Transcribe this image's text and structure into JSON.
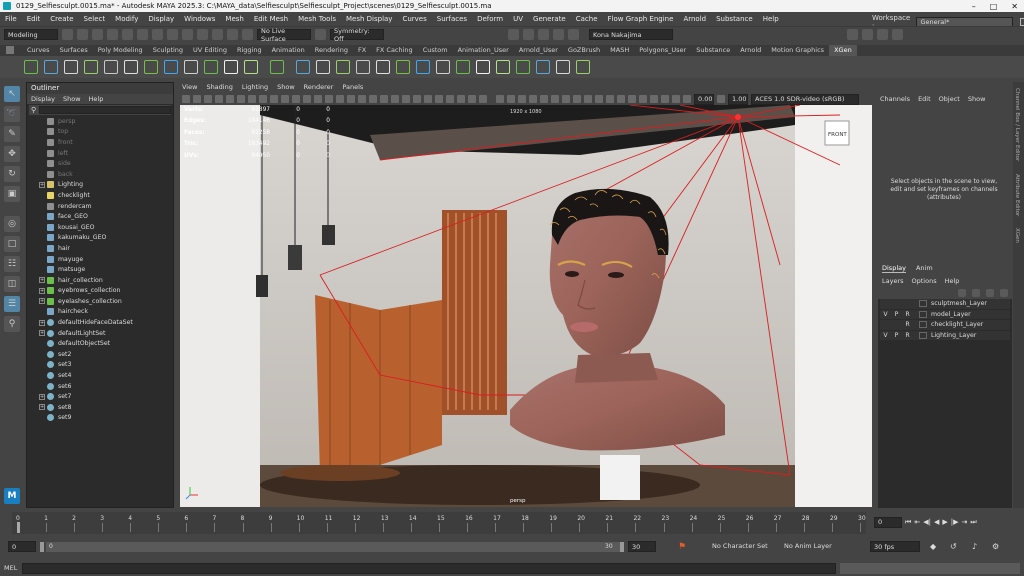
{
  "title": "0129_Selfiesculpt.0015.ma* - Autodesk MAYA 2025.3: C:\\MAYA_data\\Selfiesculpt\\Selfiesculpt_Project\\scenes\\0129_Selfiesculpt.0015.ma",
  "menus": [
    "File",
    "Edit",
    "Create",
    "Select",
    "Modify",
    "Display",
    "Windows",
    "Mesh",
    "Edit Mesh",
    "Mesh Tools",
    "Mesh Display",
    "Curves",
    "Surfaces",
    "Deform",
    "UV",
    "Generate",
    "Cache",
    "Flow Graph Engine",
    "Arnold",
    "Substance",
    "Help"
  ],
  "workspace_label": "Workspace :",
  "workspace_value": "General*",
  "mode_menu": "Modeling",
  "live_surface": "No Live Surface",
  "symmetry": "Symmetry: Off",
  "user": "Kona Nakajima",
  "shelf_tabs": [
    "Curves",
    "Surfaces",
    "Poly Modeling",
    "Sculpting",
    "UV Editing",
    "Rigging",
    "Animation",
    "Rendering",
    "FX",
    "FX Caching",
    "Custom",
    "Animation_User",
    "Arnold_User",
    "GoZBrush",
    "MASH",
    "Polygons_User",
    "Substance",
    "Arnold",
    "Motion Graphics",
    "XGen"
  ],
  "active_shelf": "XGen",
  "shelf_colors": [
    "#6cbf4a",
    "#5aa8d8",
    "#d8d8d8",
    "#9ad06a",
    "#c8c8c8",
    "#e0e0e0",
    "#7ac143",
    "#3fa9f5",
    "#d0d0d0",
    "#6cbf4a",
    "#f0f0f0",
    "#b5e08a"
  ],
  "outliner": {
    "title": "Outliner",
    "menus": [
      "Display",
      "Show",
      "Help"
    ],
    "items": [
      {
        "label": "persp",
        "kind": "cam",
        "dim": true,
        "indent": 1
      },
      {
        "label": "top",
        "kind": "cam",
        "dim": true,
        "indent": 1
      },
      {
        "label": "front",
        "kind": "cam",
        "dim": true,
        "indent": 1
      },
      {
        "label": "left",
        "kind": "cam",
        "dim": true,
        "indent": 1
      },
      {
        "label": "side",
        "kind": "cam",
        "dim": true,
        "indent": 1
      },
      {
        "label": "back",
        "kind": "cam",
        "dim": true,
        "indent": 1
      },
      {
        "label": "Lighting",
        "kind": "group",
        "dim": false,
        "indent": 0,
        "expand": true
      },
      {
        "label": "checklight",
        "kind": "light",
        "dim": false,
        "indent": 1
      },
      {
        "label": "rendercam",
        "kind": "cam",
        "dim": false,
        "indent": 1
      },
      {
        "label": "face_GEO",
        "kind": "mesh",
        "dim": false,
        "indent": 1
      },
      {
        "label": "kousai_GEO",
        "kind": "mesh",
        "dim": false,
        "indent": 1
      },
      {
        "label": "kakumaku_GEO",
        "kind": "mesh",
        "dim": false,
        "indent": 1
      },
      {
        "label": "hair",
        "kind": "mesh",
        "dim": false,
        "indent": 1
      },
      {
        "label": "mayuge",
        "kind": "mesh",
        "dim": false,
        "indent": 1
      },
      {
        "label": "matsuge",
        "kind": "mesh",
        "dim": false,
        "indent": 1
      },
      {
        "label": "hair_collection",
        "kind": "xgen",
        "dim": false,
        "indent": 0,
        "expand": true
      },
      {
        "label": "eyebrows_collection",
        "kind": "xgen",
        "dim": false,
        "indent": 0,
        "expand": true
      },
      {
        "label": "eyelashes_collection",
        "kind": "xgen",
        "dim": false,
        "indent": 0,
        "expand": true
      },
      {
        "label": "haircheck",
        "kind": "mesh",
        "dim": false,
        "indent": 1
      },
      {
        "label": "defaultHideFaceDataSet",
        "kind": "set",
        "dim": false,
        "indent": 0,
        "expand": true
      },
      {
        "label": "defaultLightSet",
        "kind": "set",
        "dim": false,
        "indent": 0,
        "expand": true
      },
      {
        "label": "defaultObjectSet",
        "kind": "set",
        "dim": false,
        "indent": 1
      },
      {
        "label": "set2",
        "kind": "set",
        "dim": false,
        "indent": 1
      },
      {
        "label": "set3",
        "kind": "set",
        "dim": false,
        "indent": 1
      },
      {
        "label": "set4",
        "kind": "set",
        "dim": false,
        "indent": 1
      },
      {
        "label": "set6",
        "kind": "set",
        "dim": false,
        "indent": 1
      },
      {
        "label": "set7",
        "kind": "set",
        "dim": false,
        "indent": 0,
        "expand": true
      },
      {
        "label": "set8",
        "kind": "set",
        "dim": false,
        "indent": 0,
        "expand": true
      },
      {
        "label": "set9",
        "kind": "set",
        "dim": false,
        "indent": 1
      }
    ]
  },
  "viewport": {
    "menus": [
      "View",
      "Shading",
      "Lighting",
      "Show",
      "Renderer",
      "Panels"
    ],
    "exposure": "0.00",
    "gamma": "1.00",
    "color_space": "ACES 1.0 SDR-video (sRGB)",
    "camera": "persp",
    "resolution": "1920 x 1080",
    "viewcube": "FRONT",
    "hud": [
      {
        "k": "Verts:",
        "v": "91897",
        "a": "0",
        "b": "0"
      },
      {
        "k": "Edges:",
        "v": "184146",
        "a": "0",
        "b": "0"
      },
      {
        "k": "Faces:",
        "v": "92258",
        "a": "0",
        "b": "0"
      },
      {
        "k": "Tris:",
        "v": "183492",
        "a": "0",
        "b": "0"
      },
      {
        "k": "UVs:",
        "v": "94050",
        "a": "0",
        "b": "0"
      }
    ]
  },
  "channel_box": {
    "menus": [
      "Channels",
      "Edit",
      "Object",
      "Show"
    ],
    "message": "Select objects in the scene to view, edit and set keyframes on channels (attributes)"
  },
  "layer_editor": {
    "tabs": [
      "Display",
      "Anim"
    ],
    "menus": [
      "Layers",
      "Options",
      "Help"
    ],
    "layers": [
      {
        "v": "",
        "p": "",
        "r": "",
        "name": "sculptmesh_Layer"
      },
      {
        "v": "V",
        "p": "P",
        "r": "R",
        "name": "model_Layer"
      },
      {
        "v": "",
        "p": "",
        "r": "R",
        "name": "checklight_Layer"
      },
      {
        "v": "V",
        "p": "P",
        "r": "R",
        "name": "Lighting_Layer"
      }
    ]
  },
  "side_tabs": [
    "Channel Box / Layer Editor",
    "Attribute Editor",
    "XGen"
  ],
  "timeline": {
    "ticks": [
      "0",
      "1",
      "2",
      "3",
      "4",
      "5",
      "6",
      "7",
      "8",
      "9",
      "10",
      "11",
      "12",
      "13",
      "14",
      "15",
      "16",
      "17",
      "18",
      "19",
      "20",
      "21",
      "22",
      "23",
      "24",
      "25",
      "26",
      "27",
      "28",
      "29",
      "30"
    ],
    "current": "0"
  },
  "range": {
    "start": "0",
    "inner_start": "0",
    "inner_end": "30",
    "end": "30",
    "char_set": "No Character Set",
    "anim_layer": "No Anim Layer",
    "fps": "30 fps"
  },
  "command": {
    "label": "MEL"
  }
}
